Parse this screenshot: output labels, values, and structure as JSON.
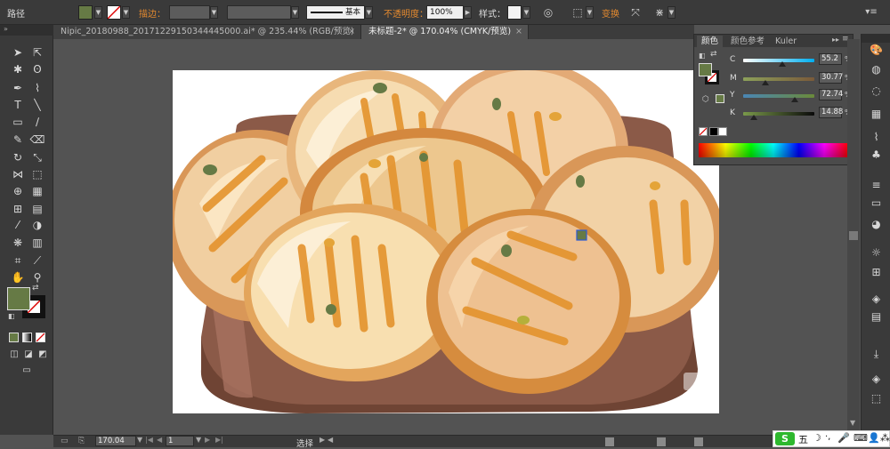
{
  "control_bar": {
    "object_type": "路径",
    "fill_color": "#667a45",
    "stroke_label": "描边：",
    "brush_label": "基本",
    "opacity_label": "不透明度：",
    "opacity_value": "100%",
    "style_label": "样式：",
    "transform_label": "变换"
  },
  "tabs": [
    {
      "label": "Nipic_20180988_20171229150344445000.ai* @ 235.44% (RGB/预览)",
      "active": false
    },
    {
      "label": "未标题-2* @ 170.04% (CMYK/预览)",
      "active": true
    }
  ],
  "color_panel": {
    "tabs": [
      "颜色",
      "颜色参考",
      "Kuler"
    ],
    "active_tab": "颜色",
    "channels": [
      {
        "label": "C",
        "value": "55.2",
        "fraction": 0.552
      },
      {
        "label": "M",
        "value": "30.77",
        "fraction": 0.3077
      },
      {
        "label": "Y",
        "value": "72.74",
        "fraction": 0.7274
      },
      {
        "label": "K",
        "value": "14.88",
        "fraction": 0.1488
      }
    ],
    "percent": "%",
    "fill_swatch": "#667a45"
  },
  "tool_fill_color": "#667a45",
  "status_bar": {
    "zoom": "170.04",
    "page": "1",
    "tool_status": "选择"
  },
  "ime_bar": {
    "logo": "S",
    "mode": "五"
  },
  "colors": {
    "bg_dark": "#3a3a3a",
    "canvas_bg": "#535353",
    "accent_orange": "#e48a2f"
  }
}
